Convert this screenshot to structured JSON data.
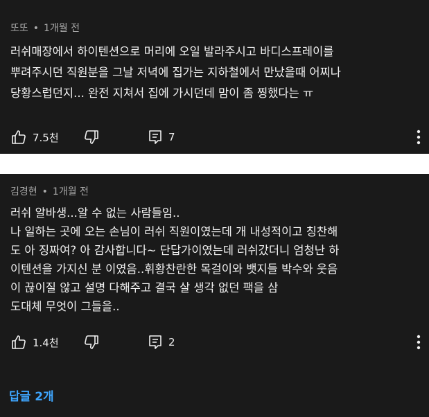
{
  "comments": [
    {
      "author": "또또",
      "separator": "•",
      "time": "1개월 전",
      "lines": [
        "러쉬매장에서 하이텐션으로 머리에 오일 발라주시고 바디스프레이를",
        "뿌려주시던 직원분을 그날 저녁에 집가는 지하철에서 만났을때 어찌나",
        "당황스럽던지... 완전 지쳐서 집에 가시던데 맘이 좀 찡했다는 ㅠ"
      ],
      "likes": "7.5천",
      "reply_count": "7",
      "icons": {
        "like": "thumbs-up-icon",
        "dislike": "thumbs-down-icon",
        "reply": "comment-icon",
        "more": "more-vertical-icon"
      }
    },
    {
      "author": "김경현",
      "separator": "•",
      "time": "1개월 전",
      "lines": [
        "러쉬 알바생...알 수 없는 사람들임..",
        "나 일하는 곳에 오는 손님이 러쉬 직원이였는데 개 내성적이고 칭찬해",
        "도 아 징짜여? 아 감사합니다~ 단답가이였는데 러쉬갔더니 엄청난 하",
        "이텐션을 가지신 분 이였음..휘황찬란한 목걸이와 뱃지들 박수와 웃음",
        "이 끊이질 않고 설명 다해주고 결국 살 생각 없던 팩을 삼",
        "도대체 무엇이 그들을.."
      ],
      "likes": "1.4천",
      "reply_count": "2",
      "view_replies": "답글 2개",
      "icons": {
        "like": "thumbs-up-icon",
        "dislike": "thumbs-down-icon",
        "reply": "comment-icon",
        "more": "more-vertical-icon"
      }
    }
  ],
  "colors": {
    "panel_bg": "#1a1a1a",
    "separator_bg": "#ffffff",
    "text": "#f1f1f1",
    "meta": "#aaaaaa",
    "link": "#3ea6ff"
  }
}
